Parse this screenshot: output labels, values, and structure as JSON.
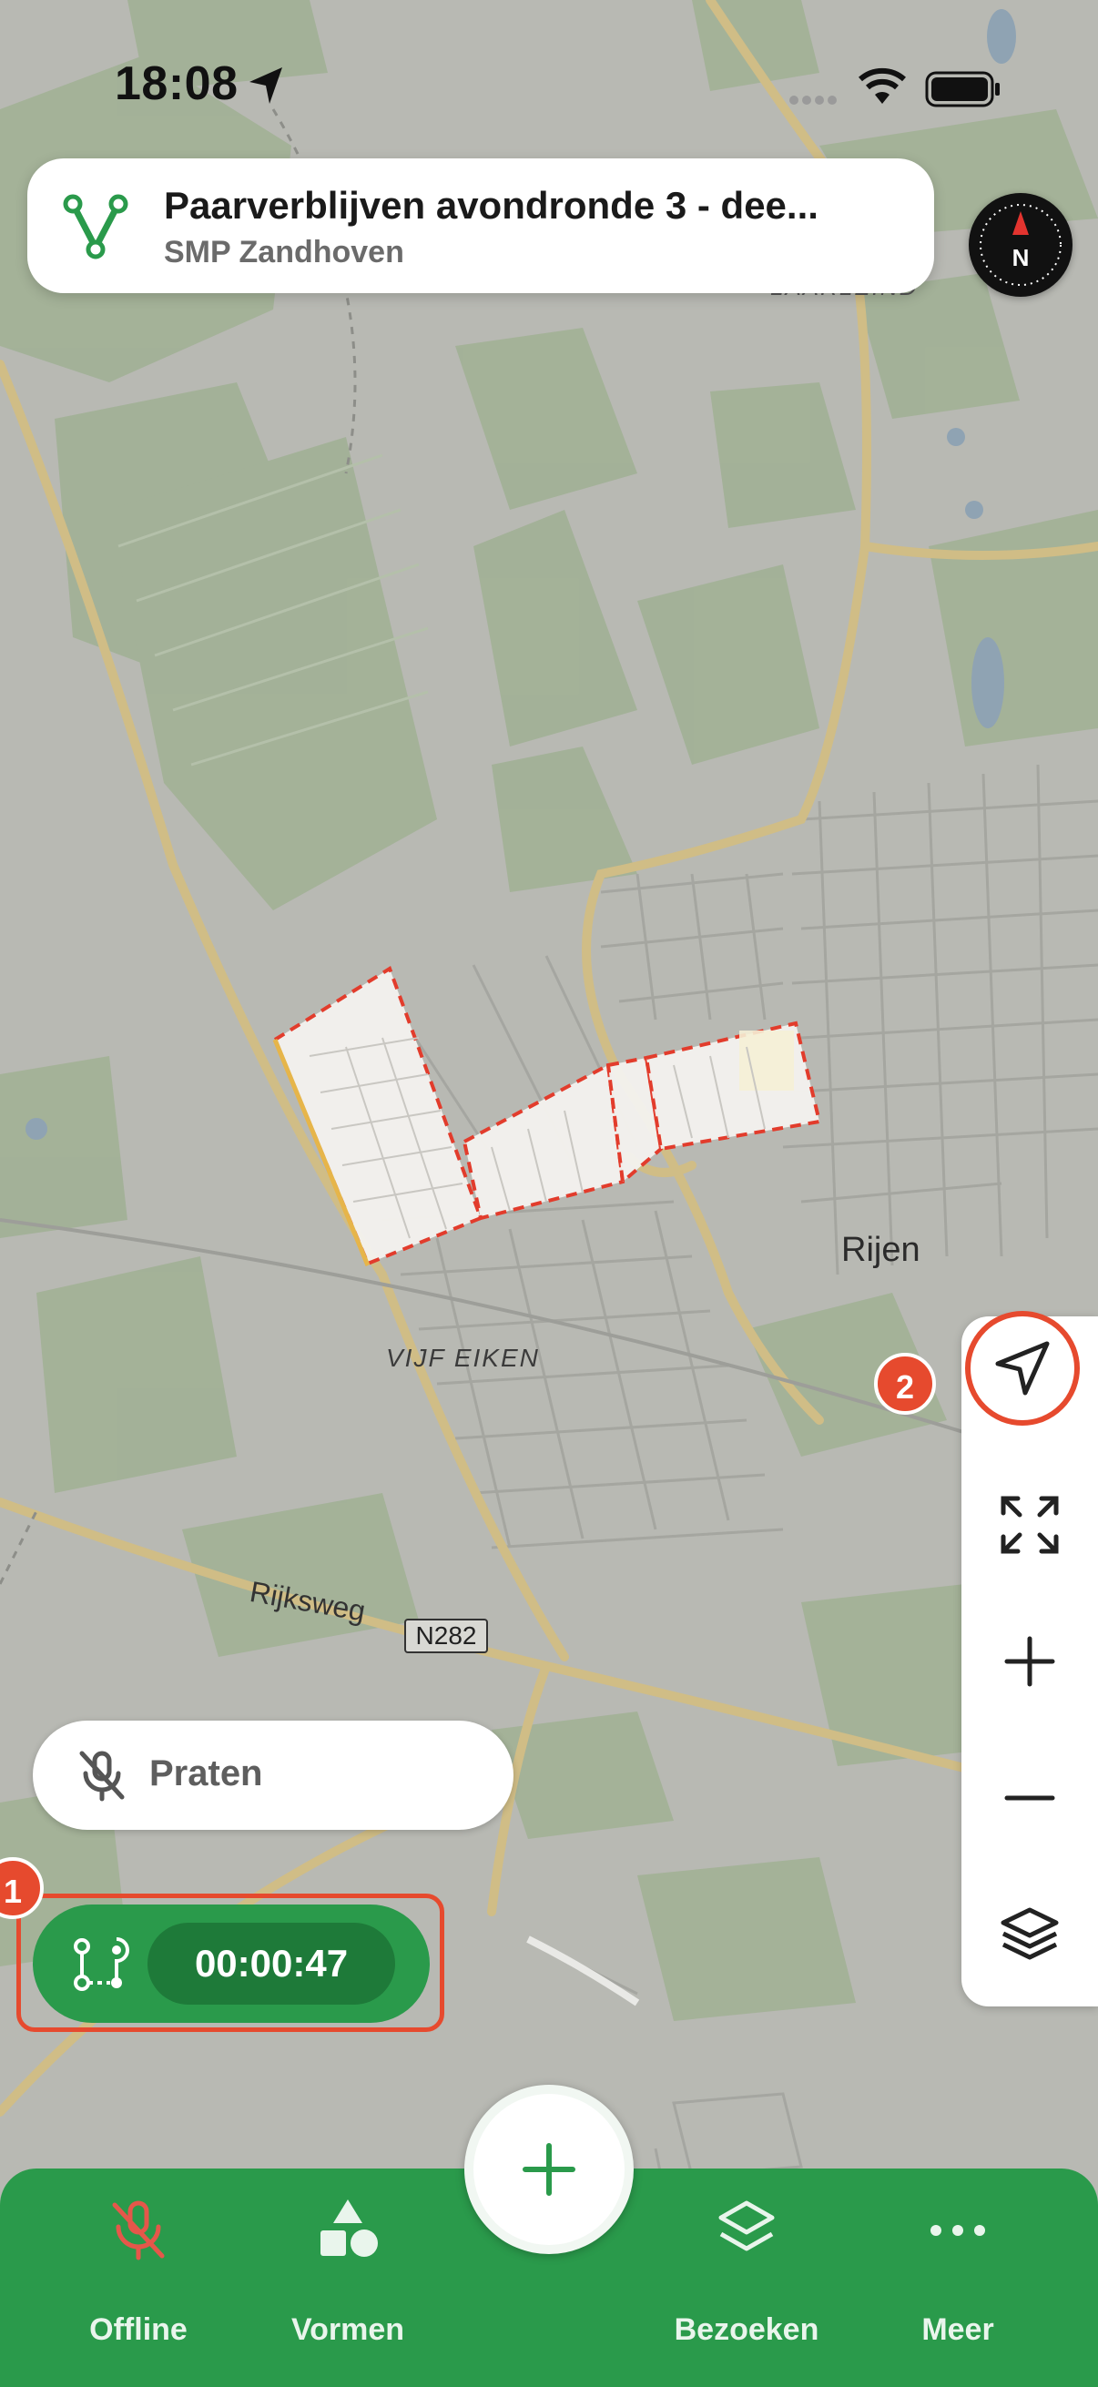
{
  "status_bar": {
    "time": "18:08"
  },
  "header": {
    "title": "Paarverblijven avondronde 3 - dee...",
    "subtitle": "SMP Zandhoven"
  },
  "compass": {
    "label": "N"
  },
  "map": {
    "labels": {
      "town": "Rijen",
      "area_north": "LAARLEIND",
      "area_west": "VIJF EIKEN",
      "road": "Rijksweg",
      "road_shield": "N282"
    },
    "colors": {
      "background": "#b9bab4",
      "fields": "#9fae94",
      "roads": "#c9b783",
      "selection_fill": "#f4f1ee",
      "selection_border": "#e23c2c"
    }
  },
  "markers": {
    "first": "1",
    "second": "2"
  },
  "talk": {
    "label": "Praten"
  },
  "recording": {
    "timer": "00:00:47"
  },
  "nav": {
    "offline": "Offline",
    "vormen": "Vormen",
    "bezoeken": "Bezoeken",
    "meer": "Meer"
  },
  "colors": {
    "accent_green": "#2a9a4b",
    "dark_green": "#1e7a39",
    "marker_red": "#e64a2e"
  }
}
